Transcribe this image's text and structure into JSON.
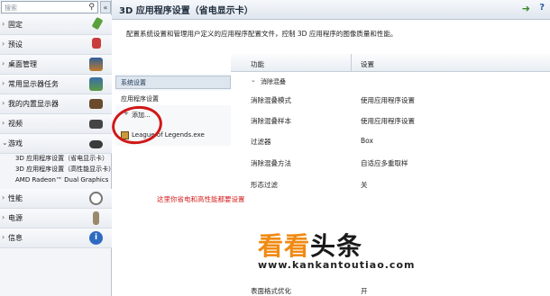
{
  "search": {
    "placeholder": "搜索"
  },
  "sidebar": {
    "categories": [
      {
        "label": "固定",
        "icon": "pin-icon",
        "color": "#5aa03c"
      },
      {
        "label": "预设",
        "icon": "preset-icon",
        "color": "#c83c3c"
      },
      {
        "label": "桌面管理",
        "icon": "desktop-management-icon",
        "color": "#c07a2a"
      },
      {
        "label": "常用显示器任务",
        "icon": "display-tasks-icon",
        "color": "#5a9a44"
      },
      {
        "label": "我的内置显示器",
        "icon": "laptop-display-icon",
        "color": "#6a4a2a"
      },
      {
        "label": "视频",
        "icon": "video-icon",
        "color": "#444444"
      },
      {
        "label": "游戏",
        "icon": "gamepad-icon",
        "color": "#3a3a3a"
      }
    ],
    "game_subitems": [
      "3D 应用程序设置（省电显示卡）",
      "3D 应用程序设置（高性能显示卡）",
      "AMD Radeon™ Dual Graphics"
    ],
    "bottom_categories": [
      {
        "label": "性能",
        "icon": "performance-gauge-icon",
        "color": "#777777"
      },
      {
        "label": "电源",
        "icon": "battery-icon",
        "color": "#9a8a6a"
      },
      {
        "label": "信息",
        "icon": "info-icon",
        "color": "#2e6ac0"
      }
    ]
  },
  "header": {
    "title": "3D 应用程序设置（省电显示卡）"
  },
  "description": "配置系统设置和管理用户定义的应用程序配置文件，控制 3D 应用程序的图像质量和性能。",
  "tabs": {
    "global": "系统设置",
    "program": "应用程序设置",
    "add": "添加...",
    "program_name": "League of Legends.exe"
  },
  "table": {
    "headers": [
      "功能",
      "设置"
    ],
    "group": "消除混叠",
    "rows": [
      {
        "feature": "消除混叠模式",
        "value": "使用应用程序设置"
      },
      {
        "feature": "消除混叠样本",
        "value": "使用应用程序设置"
      },
      {
        "feature": "过滤器",
        "value": "Box"
      },
      {
        "feature": "消除混叠方法",
        "value": "自适应多重取样"
      },
      {
        "feature": "形态过滤",
        "value": "关"
      },
      {
        "feature": "表面格式优化",
        "value": "开"
      }
    ]
  },
  "annotation": "这里你省电和高性能都要设置",
  "watermark": {
    "logo_a": "看看",
    "logo_b": "头条",
    "url": "www.kankantoutiao.com"
  }
}
